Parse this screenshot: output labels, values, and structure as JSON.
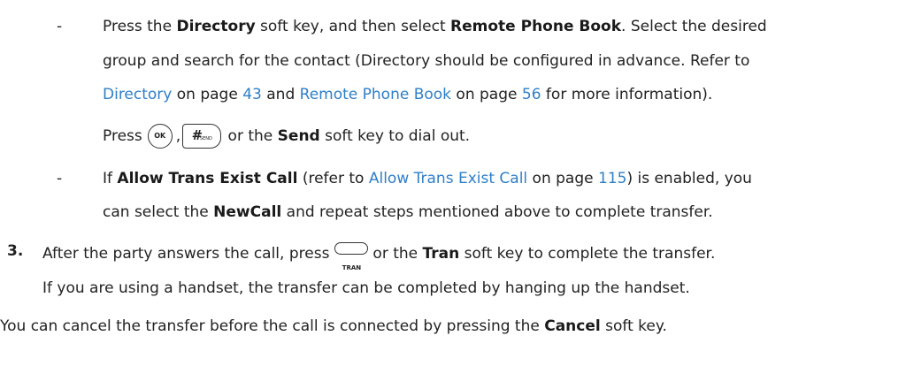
{
  "step_list": {
    "bullet1": {
      "marker": "-",
      "l1_a": "Press the ",
      "l1_b": "Directory",
      "l1_c": " soft key, and then select ",
      "l1_d": "Remote Phone Book",
      "l1_e": ". Select the desired",
      "l2": "group and search for the contact (Directory should be configured in advance. Refer to",
      "l3_link1": "Directory",
      "l3_a": " on page ",
      "l3_page1": "43",
      "l3_b": " and ",
      "l3_link2": "Remote Phone Book",
      "l3_c": " on page ",
      "l3_page2": "56",
      "l3_d": " for more information).",
      "l4_a": "Press",
      "l4_ok": "OK",
      "l4_comma": ",",
      "l4_send_hash": "#",
      "l4_send_sub": "SEND",
      "l4_b": " or the ",
      "l4_send": "Send",
      "l4_c": " soft key to dial out."
    },
    "bullet2": {
      "marker": "-",
      "l1_a": "If ",
      "l1_b": "Allow Trans Exist Call",
      "l1_c": " (refer to ",
      "l1_link": "Allow Trans Exist Call",
      "l1_d": " on page ",
      "l1_page": "115",
      "l1_e": ") is enabled, you",
      "l2_a": "can select the ",
      "l2_b": "NewCall",
      "l2_c": " and repeat steps mentioned above to complete transfer."
    },
    "step3": {
      "number": "3.",
      "l1_a": "After the party answers the call, press",
      "l1_key": "TRAN",
      "l1_b": "or the ",
      "l1_c": "Tran",
      "l1_d": " soft key to complete the transfer.",
      "l2": "If you are using a handset, the transfer can be completed by hanging up the handset."
    }
  },
  "footer_note": {
    "a": "You can cancel the transfer before the call is connected by pressing the ",
    "b": "Cancel",
    "c": " soft key."
  },
  "colors": {
    "link": "#2f7fc8",
    "text": "#222222"
  }
}
